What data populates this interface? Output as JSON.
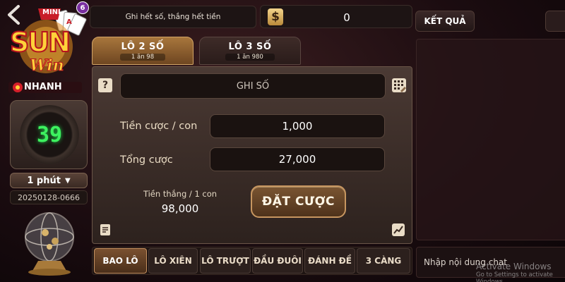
{
  "header": {
    "note_text": "Ghi hết số, thắng hết tiền",
    "balance": "0",
    "currency_symbol": "$"
  },
  "logo": {
    "badge": "MINI",
    "notification_count": "6",
    "brand_line1": "SUN",
    "brand_line2": "Win",
    "brand_line3": "NHANH"
  },
  "timer": {
    "countdown": "39",
    "interval": "1 phút",
    "session_id": "20250128-0666"
  },
  "game_tabs": [
    {
      "label": "LÔ 2 SỐ",
      "sub": "1 ăn 98",
      "active": true
    },
    {
      "label": "LÔ 3 SỐ",
      "sub": "1 ăn 980",
      "active": false
    }
  ],
  "form": {
    "number_placeholder": "GHI SỐ",
    "bet_per_unit_label": "Tiền cược / con",
    "bet_per_unit_value": "1,000",
    "total_label": "Tổng cược",
    "total_value": "27,000",
    "win_label": "Tiền thắng / 1 con",
    "win_value": "98,000",
    "place_bet_label": "ĐẶT CƯỢC"
  },
  "bet_types": [
    {
      "label": "BAO LÔ",
      "active": true
    },
    {
      "label": "LÔ XIÊN",
      "active": false
    },
    {
      "label": "LÔ TRƯỢT",
      "active": false
    },
    {
      "label": "ĐẦU ĐUÔI",
      "active": false
    },
    {
      "label": "ĐÁNH ĐỀ",
      "active": false
    },
    {
      "label": "3 CÀNG",
      "active": false
    }
  ],
  "right_panel": {
    "result_button": "KẾT QUẢ",
    "chat_placeholder": "Nhập nội dung chat"
  },
  "watermark": {
    "title": "Activate Windows",
    "subtitle": "Go to Settings to activate Windows."
  },
  "colors": {
    "accent_gold": "#c79660",
    "timer_green": "#3df15f",
    "logo_red": "#d6202a",
    "logo_yellow": "#ffd23a"
  }
}
